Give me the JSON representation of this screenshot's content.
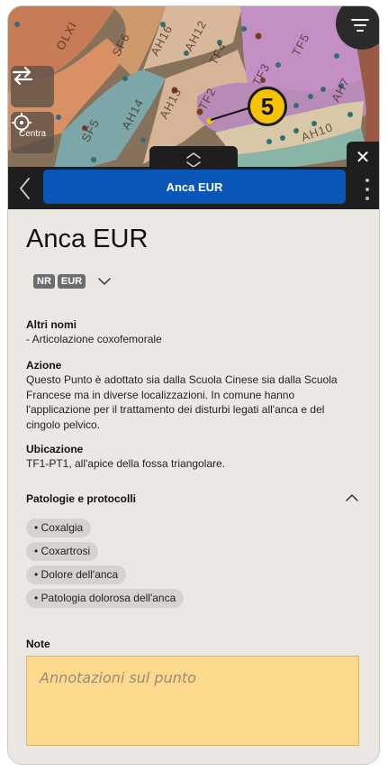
{
  "map": {
    "labels": [
      "OLXI",
      "SF6",
      "AH16",
      "AH12",
      "TF4",
      "TF5",
      "TF3",
      "SF5",
      "AH14",
      "AH13",
      "TF2",
      "AH10",
      "AH7"
    ],
    "point_number": "5",
    "center_label": "Centra",
    "icons": {
      "filter": "filter-icon",
      "swap": "swap-arrows-icon",
      "center": "crosshair-icon",
      "handle": "chevron-up-down-icon",
      "close": "close-icon"
    },
    "close_glyph": "✕"
  },
  "titlebar": {
    "title": "Anca EUR"
  },
  "point": {
    "name": "Anca EUR",
    "tags": [
      "NR",
      "EUR"
    ],
    "altri_nomi_heading": "Altri nomi",
    "altri_nomi_text": "- Articolazione coxofemorale",
    "azione_heading": "Azione",
    "azione_text": "Questo Punto è adottato sia dalla Scuola Cinese sia dalla Scuola Francese ma in diverse localizzazioni. In comune hanno l'applicazione per il trattamento dei disturbi legati all'anca e del cingolo pelvico.",
    "ubicazione_heading": "Ubicazione",
    "ubicazione_text": "TF1-PT1, all'apice della fossa triangolare.",
    "patologie_heading": "Patologie e protocolli",
    "patologie": [
      "• Coxalgia",
      "• Coxartrosi",
      "• Dolore dell'anca",
      "• Patologia dolorosa dell'anca"
    ],
    "note_heading": "Note",
    "note_placeholder": "Annotazioni sul punto",
    "note_value": ""
  },
  "colors": {
    "accent_blue": "#0a56b8",
    "note_yellow": "#fdd98d",
    "badge_yellow": "#f7c200"
  }
}
